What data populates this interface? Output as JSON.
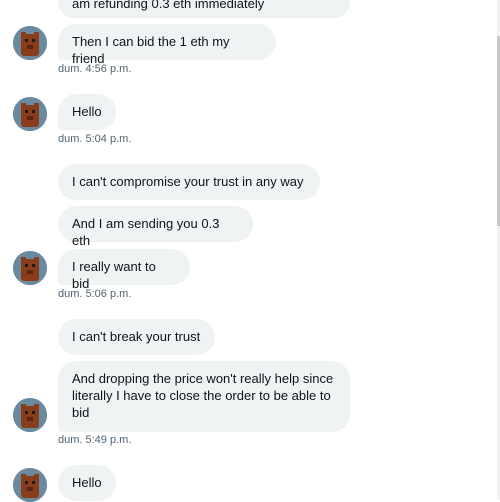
{
  "messages": [
    {
      "text": "am refunding 0.3 eth immediately"
    },
    {
      "text": "Then I can bid the 1 eth my friend"
    },
    {
      "text": "Hello"
    },
    {
      "text": "I can't compromise  your trust in any way"
    },
    {
      "text": "And I am sending you 0.3 eth"
    },
    {
      "text": "I really want to bid"
    },
    {
      "text": "I can't break your trust"
    },
    {
      "text": "And dropping the price won't really help since literally  I have to close the order to be able to bid"
    },
    {
      "text": "Hello"
    }
  ],
  "timestamps": [
    "dum. 4:56 p.m.",
    "dum. 5:04 p.m.",
    "dum. 5:06 p.m.",
    "dum. 5:49 p.m."
  ],
  "avatar_icon": "bear-avatar-icon",
  "colors": {
    "bubble": "#eff3f4",
    "text": "#0f1419",
    "timestamp": "#536471"
  }
}
